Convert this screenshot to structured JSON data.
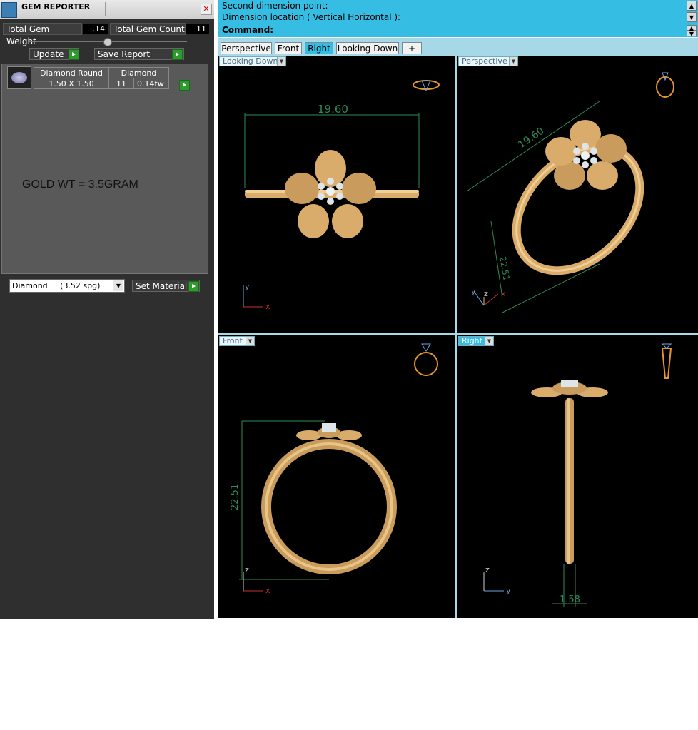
{
  "gem_reporter": {
    "title": "GEM REPORTER",
    "close_glyph": "✕",
    "total_gem_weight_label": "Total Gem Weight",
    "total_gem_weight_value": ".14",
    "total_gem_count_label": "Total Gem Count",
    "total_gem_count_value": "11",
    "update_label": "Update",
    "save_report_label": "Save Report",
    "gem_table": {
      "col1_header": "Diamond Round",
      "col2_header": "Diamond",
      "size": "1.50 X 1.50",
      "count": "11",
      "weight": "0.14tw"
    },
    "gold_weight_text": "GOLD WT =  3.5GRAM",
    "material_select": "Diamond     (3.52 spg)",
    "set_material_label": "Set Material"
  },
  "command": {
    "line1": "Second dimension point:",
    "line2": "Dimension location ( Vertical  Horizontal ):",
    "prompt": "Command:"
  },
  "tabs": [
    "Perspective",
    "Front",
    "Right",
    "Looking Down",
    "+"
  ],
  "active_tab": "Right",
  "viewports": {
    "top_left": {
      "label": "Looking Down",
      "dimension": "19.60",
      "axis_h": "x",
      "axis_v": "y"
    },
    "top_right": {
      "label": "Perspective",
      "dimension_width": "19.60",
      "dimension_height": "22.51",
      "axis_a": "y",
      "axis_b": "z",
      "axis_c": "x"
    },
    "bottom_left": {
      "label": "Front",
      "dimension": "22.51",
      "axis_h": "x",
      "axis_v": "z"
    },
    "bottom_right": {
      "label": "Right",
      "dimension": "1.58",
      "axis_h": "y",
      "axis_v": "z"
    }
  },
  "colors": {
    "accent_cyan": "#36bde3",
    "panel_bg": "#2f2f2f",
    "gold": "#d9ac6c",
    "dimension_green": "#2e8b57",
    "play_green": "#2e9b2e"
  }
}
